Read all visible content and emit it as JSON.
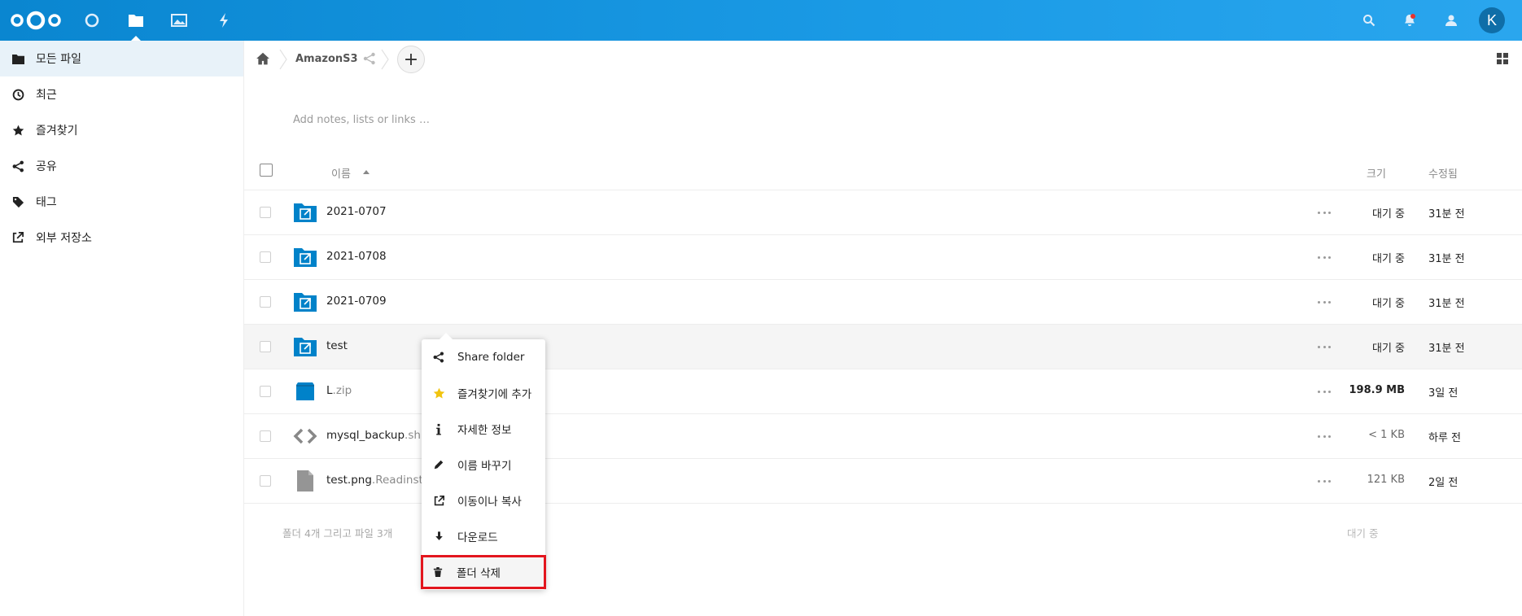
{
  "header": {
    "logo": "nextcloud-logo",
    "apps": [
      "dashboard-icon",
      "files-icon",
      "photos-icon",
      "activity-icon"
    ],
    "right_icons": [
      "search-icon",
      "notifications-icon",
      "contacts-icon"
    ],
    "avatar_letter": "K",
    "accent": "#0a86d0"
  },
  "sidebar": {
    "items": [
      {
        "label": "모든 파일",
        "icon": "folder-icon"
      },
      {
        "label": "최근",
        "icon": "clock-icon"
      },
      {
        "label": "즐겨찾기",
        "icon": "star-icon"
      },
      {
        "label": "공유",
        "icon": "share-icon"
      },
      {
        "label": "태그",
        "icon": "tag-icon"
      },
      {
        "label": "외부 저장소",
        "icon": "external-link-icon"
      }
    ]
  },
  "breadcrumb": {
    "folder": "AmazonS3",
    "add_label": "+"
  },
  "notes_placeholder": "Add notes, lists or links …",
  "table": {
    "headers": {
      "name": "이름",
      "size": "크기",
      "modified": "수정됨"
    },
    "rows": [
      {
        "name": "2021-0707",
        "ext": "",
        "type": "external-folder",
        "size": "대기 중",
        "modified": "31분 전"
      },
      {
        "name": "2021-0708",
        "ext": "",
        "type": "external-folder",
        "size": "대기 중",
        "modified": "31분 전"
      },
      {
        "name": "2021-0709",
        "ext": "",
        "type": "external-folder",
        "size": "대기 중",
        "modified": "31분 전"
      },
      {
        "name": "test",
        "ext": "",
        "type": "external-folder",
        "size": "대기 중",
        "modified": "31분 전"
      },
      {
        "name": "L",
        "ext": ".zip",
        "type": "archive",
        "size": "198.9 MB",
        "modified": "3일 전"
      },
      {
        "name": "mysql_backup",
        "ext": ".sh",
        "type": "code",
        "size": "< 1 KB",
        "modified": "하루 전"
      },
      {
        "name": "test.png",
        "ext": ".Readinstr",
        "type": "file",
        "size": "121 KB",
        "modified": "2일 전"
      }
    ],
    "summary": "폴더 4개 그리고 파일 3개",
    "summary_size": "대기 중"
  },
  "context_menu": {
    "items": [
      {
        "label": "Share folder",
        "icon": "share-icon"
      },
      {
        "label": "즐겨찾기에 추가",
        "icon": "star-icon"
      },
      {
        "label": "자세한 정보",
        "icon": "info-icon"
      },
      {
        "label": "이름 바꾸기",
        "icon": "pencil-icon"
      },
      {
        "label": "이동이나 복사",
        "icon": "external-link-icon"
      },
      {
        "label": "다운로드",
        "icon": "download-icon"
      },
      {
        "label": "폴더 삭제",
        "icon": "trash-icon"
      }
    ],
    "highlight_color": "#e3161e"
  }
}
